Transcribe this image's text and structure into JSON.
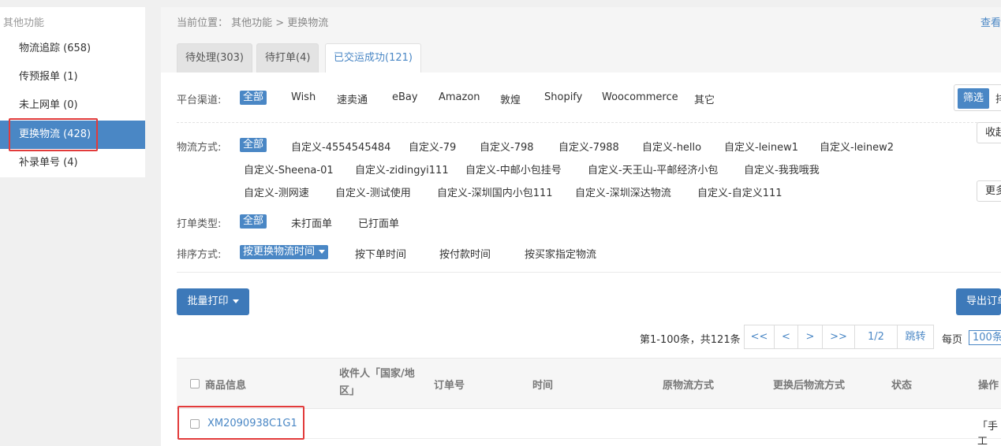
{
  "sidebar": {
    "title": "其他功能",
    "items": [
      {
        "label": "物流追踪 (658)"
      },
      {
        "label": "传预报单 (1)"
      },
      {
        "label": "未上网单 (0)"
      },
      {
        "label": "更换物流 (428)",
        "active": true
      },
      {
        "label": "补录单号 (4)"
      }
    ]
  },
  "breadcrumb": {
    "text": "当前位置： 其他功能 > 更换物流",
    "right_link": "查看"
  },
  "tabs": [
    {
      "label": "待处理(303)"
    },
    {
      "label": "待打单(4)"
    },
    {
      "label": "已交运成功(121)",
      "active": true
    }
  ],
  "filters": {
    "platform": {
      "label": "平台渠道:",
      "options": [
        "全部",
        "Wish",
        "速卖通",
        "eBay",
        "Amazon",
        "敦煌",
        "Shopify",
        "Woocommerce",
        "其它"
      ]
    },
    "logistics": {
      "label": "物流方式:",
      "options": [
        "全部",
        "自定义-4554545484",
        "自定义-79",
        "自定义-798",
        "自定义-7988",
        "自定义-hello",
        "自定义-leinew1",
        "自定义-leinew2",
        "自定义-Sheena-01",
        "自定义-zidingyi111",
        "自定义-中邮小包挂号",
        "自定义-天王山-平邮经济小包",
        "自定义-我我哦我",
        "自定义-测网速",
        "自定义-测试使用",
        "自定义-深圳国内小包111",
        "自定义-深圳深达物流",
        "自定义-自定义111"
      ]
    },
    "print_type": {
      "label": "打单类型:",
      "options": [
        "全部",
        "未打面单",
        "已打面单"
      ]
    },
    "sort": {
      "label": "排序方式:",
      "options": [
        "按更换物流时间",
        "按下单时间",
        "按付款时间",
        "按买家指定物流"
      ]
    }
  },
  "filter_button": "筛选",
  "filter_button_next": "排",
  "collapse_button": "收起",
  "more_button": "更多",
  "actions": {
    "batch_print": "批量打印",
    "export": "导出订单"
  },
  "pagination": {
    "info": "第1-100条，共121条",
    "first": "<<",
    "prev": "<",
    "next": ">",
    "last": ">>",
    "page": "1/2",
    "jump": "跳转",
    "per_page_label": "每页",
    "per_page_value": "100条"
  },
  "table": {
    "headers": {
      "product": "商品信息",
      "recipient": "收件人「国家/地区」",
      "order_no": "订单号",
      "time": "时间",
      "orig_logistics": "原物流方式",
      "new_logistics": "更换后物流方式",
      "status": "状态",
      "ops": "操作"
    },
    "rows": [
      {
        "sku": "XM2090938C1G1",
        "ops": "「手工"
      }
    ]
  },
  "colors": {
    "accent": "#4a87c5",
    "highlight_box": "#e23b3b"
  }
}
